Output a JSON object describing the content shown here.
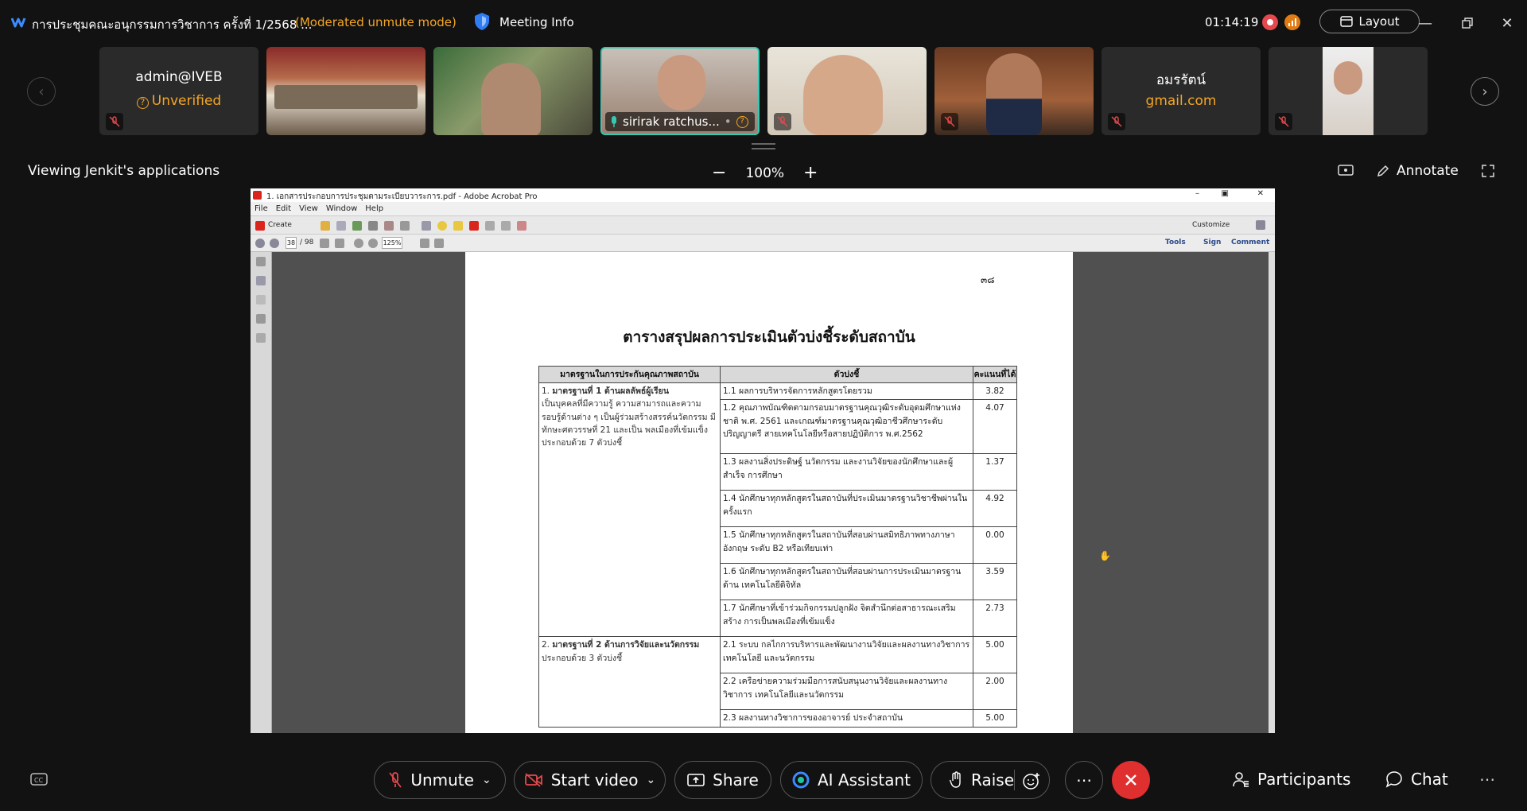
{
  "window": {
    "title": "การประชุมคณะอนุกรรมการวิชาการ ครั้งที่ 1/2568 ...",
    "mode": "(Moderated unmute mode)",
    "meeting_info": "Meeting Info",
    "timer": "01:14:19",
    "layout_label": "Layout"
  },
  "participants_strip": [
    {
      "name": "admin@IVEB",
      "sub": "Unverified",
      "muted": true
    },
    {
      "name": "",
      "sub": "",
      "muted": false
    },
    {
      "name": "",
      "sub": "",
      "muted": false
    },
    {
      "name": "sirirak ratchus...",
      "sub": "",
      "muted": false,
      "active_speaker": true
    },
    {
      "name": "",
      "sub": "",
      "muted": true
    },
    {
      "name": "",
      "sub": "",
      "muted": true
    },
    {
      "name": "อมรรัตน์",
      "sub": "gmail.com",
      "muted": true
    },
    {
      "name": "",
      "sub": "",
      "muted": true
    }
  ],
  "share": {
    "viewing_label": "Viewing Jenkit's applications",
    "zoom": "100%",
    "annotate_label": "Annotate"
  },
  "acrobat": {
    "title": "1. เอกสารประกอบการประชุมตามระเบียบวาระการ.pdf - Adobe Acrobat Pro",
    "menu": [
      "File",
      "Edit",
      "View",
      "Window",
      "Help"
    ],
    "create_label": "Create",
    "customize_label": "Customize",
    "page_current": "38",
    "page_total": "/ 98",
    "zoom": "125%",
    "right_tabs": [
      "Tools",
      "Sign",
      "Comment"
    ]
  },
  "document": {
    "page_number": "๓๘",
    "title": "ตารางสรุปผลการประเมินตัวบ่งชี้ระดับสถาบัน",
    "headers": [
      "มาตรฐานในการประกันคุณภาพสถาบัน",
      "ตัวบ่งชี้",
      "คะแนนที่ได้"
    ],
    "standard1_num": "1.",
    "standard1_bold": "มาตรฐานที่ 1 ด้านผลลัพธ์ผู้เรียน",
    "standard1_text": "เป็นบุคคลที่มีความรู้ ความสามารถและความรอบรู้ด้านต่าง ๆ เป็นผู้ร่วมสร้างสรรค์นวัตกรรม มีทักษะศตวรรษที่ 21 และเป็น พลเมืองที่เข้มแข็งประกอบด้วย 7 ตัวบ่งชี้",
    "standard2_num": "2.",
    "standard2_bold": "มาตรฐานที่ 2 ด้านการวิจัยและนวัตกรรม",
    "standard2_text": "ประกอบด้วย 3 ตัวบ่งชี้",
    "indicators": [
      {
        "text": "1.1 ผลการบริหารจัดการหลักสูตรโดยรวม",
        "score": "3.82"
      },
      {
        "text": "1.2 คุณภาพบัณฑิตตามกรอบมาตรฐานคุณวุฒิระดับอุดมศึกษาแห่งชาติ พ.ศ. 2561 และเกณฑ์มาตรฐานคุณวุฒิอาชีวศึกษาระดับปริญญาตรี สายเทคโนโลยีหรือสายปฏิบัติการ พ.ศ.2562",
        "score": "4.07"
      },
      {
        "text": "1.3 ผลงานสิ่งประดิษฐ์ นวัตกรรม และงานวิจัยของนักศึกษาและผู้สำเร็จ การศึกษา",
        "score": "1.37"
      },
      {
        "text": "1.4 นักศึกษาทุกหลักสูตรในสถาบันที่ประเมินมาตรฐานวิชาชีพผ่านใน ครั้งแรก",
        "score": "4.92"
      },
      {
        "text": "1.5 นักศึกษาทุกหลักสูตรในสถาบันที่สอบผ่านสมิทธิภาพทางภาษาอังกฤษ ระดับ B2 หรือเทียบเท่า",
        "score": "0.00"
      },
      {
        "text": "1.6 นักศึกษาทุกหลักสูตรในสถาบันที่สอบผ่านการประเมินมาตรฐานด้าน เทคโนโลยีดิจิทัล",
        "score": "3.59"
      },
      {
        "text": "1.7 นักศึกษาที่เข้าร่วมกิจกรรมปลูกฝัง จิตสำนึกต่อสาธารณะเสริมสร้าง การเป็นพลเมืองที่เข้มแข็ง",
        "score": "2.73"
      },
      {
        "text": "2.1 ระบบ กลไกการบริหารและพัฒนางานวิจัยและผลงานทางวิชาการ เทคโนโลยี และนวัตกรรม",
        "score": "5.00"
      },
      {
        "text": "2.2 เครือข่ายความร่วมมือการสนับสนุนงานวิจัยและผลงานทางวิชาการ เทคโนโลยีและนวัตกรรม",
        "score": "2.00"
      },
      {
        "text": "2.3 ผลงานทางวิชาการของอาจารย์ ประจำสถาบัน",
        "score": "5.00"
      }
    ]
  },
  "controls": {
    "unmute": "Unmute",
    "start_video": "Start video",
    "share": "Share",
    "ai_assistant": "AI Assistant",
    "raise": "Raise",
    "participants": "Participants",
    "chat": "Chat"
  },
  "colors": {
    "accent": "#f5a623",
    "active_border": "#36c8b0",
    "leave": "#e02f2f",
    "mute_red": "#e5484d"
  }
}
